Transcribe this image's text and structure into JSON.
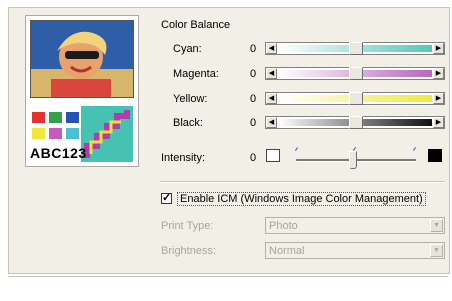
{
  "section": {
    "title": "Color Balance"
  },
  "preview": {
    "caption": "ABC123"
  },
  "balance": {
    "rows": [
      {
        "label": "Cyan:",
        "value": "0",
        "level": 0.5,
        "gradient": [
          "#ffffff",
          "#55c7b6"
        ]
      },
      {
        "label": "Magenta:",
        "value": "0",
        "level": 0.5,
        "gradient": [
          "#ffffff",
          "#b768bd"
        ]
      },
      {
        "label": "Yellow:",
        "value": "0",
        "level": 0.5,
        "gradient": [
          "#ffffff",
          "#efe840"
        ]
      },
      {
        "label": "Black:",
        "value": "0",
        "level": 0.5,
        "gradient": [
          "#ffffff",
          "#111111"
        ]
      }
    ]
  },
  "intensity": {
    "label": "Intensity:",
    "value": "0",
    "level": 0.5
  },
  "icm": {
    "label": "Enable ICM (Windows Image Color Management)",
    "checked": true,
    "check_glyph": "✓"
  },
  "print_type": {
    "label": "Print Type:",
    "value": "Photo"
  },
  "brightness": {
    "label": "Brightness:",
    "value": "Normal"
  },
  "icons": {
    "left_arrow": "◀",
    "right_arrow": "▶",
    "dropdown": "▼"
  }
}
